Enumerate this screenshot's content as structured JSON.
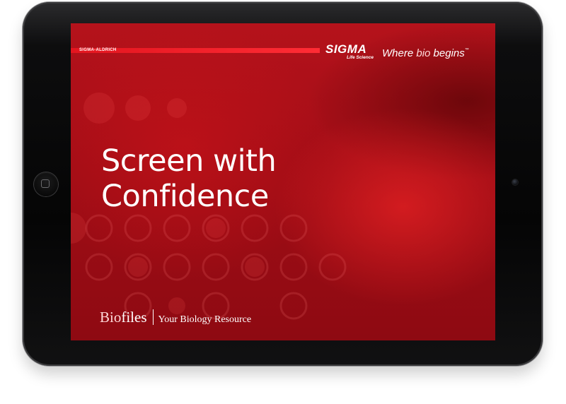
{
  "header": {
    "corporate_name": "SIGMA-ALDRICH",
    "brand": "SIGMA",
    "brand_sub": "Life Science",
    "tagline_prefix": "Where ",
    "tagline_highlight": "bio",
    "tagline_suffix": " begins",
    "trademark": "™"
  },
  "main": {
    "headline_line1": "Screen with",
    "headline_line2": "Confidence"
  },
  "footer": {
    "bio": "Bio",
    "files": "files",
    "resource": "Your Biology Resource"
  },
  "colors": {
    "screen_red": "#a10d16",
    "stripe_red": "#e3151f",
    "bezel": "#050505"
  },
  "icons": {
    "home_button": "home-button-icon",
    "camera": "front-camera-icon"
  }
}
